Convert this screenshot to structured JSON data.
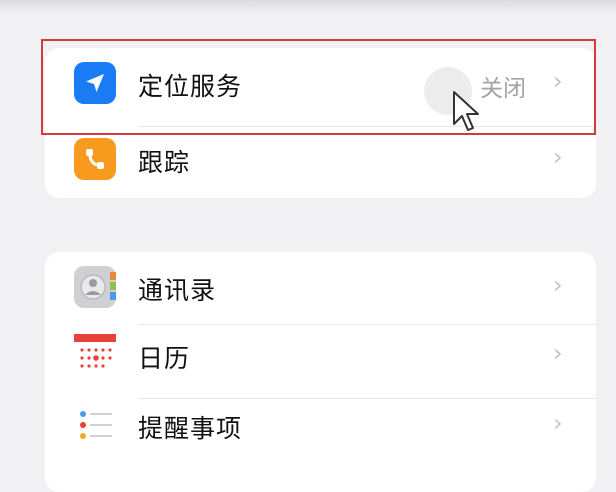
{
  "privacy_group": {
    "location_services": {
      "label": "定位服务",
      "value": "关闭",
      "icon": "location-arrow-icon",
      "icon_color": "#1a7cf5"
    },
    "tracking": {
      "label": "跟踪",
      "icon": "tracking-icon",
      "icon_color": "#f79a1e"
    }
  },
  "apps_group": {
    "contacts": {
      "label": "通讯录",
      "icon": "contacts-icon"
    },
    "calendar": {
      "label": "日历",
      "icon": "calendar-icon"
    },
    "reminders": {
      "label": "提醒事项",
      "icon": "reminders-icon"
    }
  },
  "chevron": "›",
  "highlight_color": "#d43a3a"
}
